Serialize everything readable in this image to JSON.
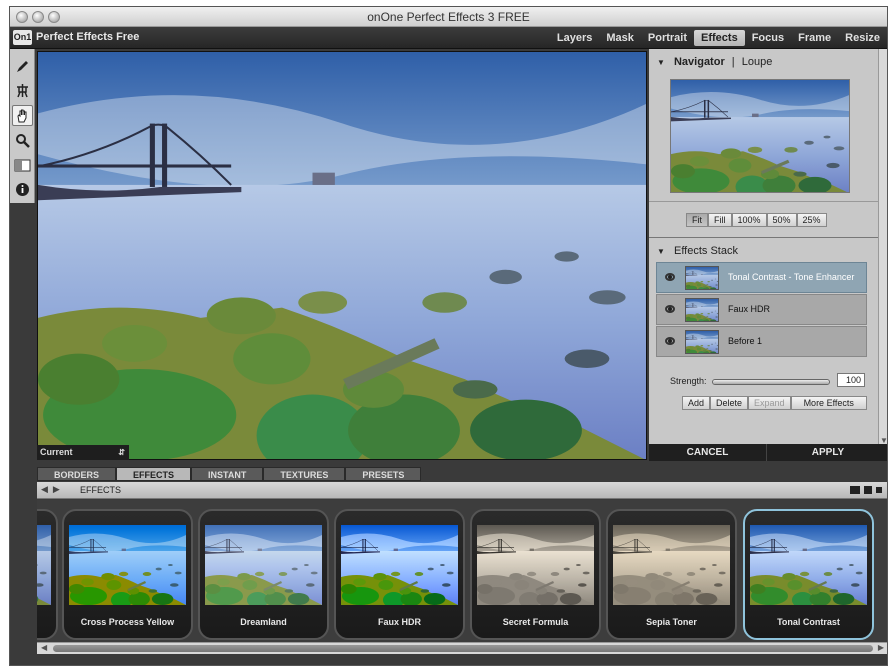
{
  "window": {
    "title": "onOne Perfect Effects 3 FREE"
  },
  "menubar": {
    "logo": "On1",
    "app_name": "Perfect Effects Free",
    "modules": [
      "Layers",
      "Mask",
      "Portrait",
      "Effects",
      "Focus",
      "Frame",
      "Resize"
    ],
    "active_module": "Effects"
  },
  "tools": [
    "brush-icon",
    "masking-bug-icon",
    "hand-icon",
    "zoom-icon",
    "compare-icon",
    "info-icon"
  ],
  "canvas": {
    "view_mode": "Current"
  },
  "navigator": {
    "tab_navigator": "Navigator",
    "separator": "|",
    "tab_loupe": "Loupe",
    "zoom_buttons": [
      "Fit",
      "Fill",
      "100%",
      "50%",
      "25%"
    ],
    "active_zoom": "Fit"
  },
  "effects_stack": {
    "title": "Effects Stack",
    "items": [
      {
        "label": "Tonal Contrast - Tone Enhancer",
        "selected": true
      },
      {
        "label": "Faux HDR",
        "selected": false
      },
      {
        "label": "Before 1",
        "selected": false
      }
    ],
    "strength_label": "Strength:",
    "strength_value": "100",
    "strength_fraction": 1.0,
    "buttons": {
      "add": "Add",
      "delete": "Delete",
      "expand": "Expand",
      "more": "More Effects"
    }
  },
  "actions": {
    "cancel": "CANCEL",
    "apply": "APPLY"
  },
  "browser": {
    "tabs": [
      "BORDERS",
      "EFFECTS",
      "INSTANT",
      "TEXTURES",
      "PRESETS"
    ],
    "active_tab": "EFFECTS",
    "section_title": "EFFECTS",
    "presets": [
      {
        "label": "Cross Process Yellow",
        "style": "cross"
      },
      {
        "label": "Dreamland",
        "style": "dream"
      },
      {
        "label": "Faux HDR",
        "style": "hdr"
      },
      {
        "label": "Secret Formula",
        "style": "secret"
      },
      {
        "label": "Sepia Toner",
        "style": "sepia"
      },
      {
        "label": "Tonal Contrast",
        "style": "tonal",
        "selected": true
      }
    ]
  }
}
